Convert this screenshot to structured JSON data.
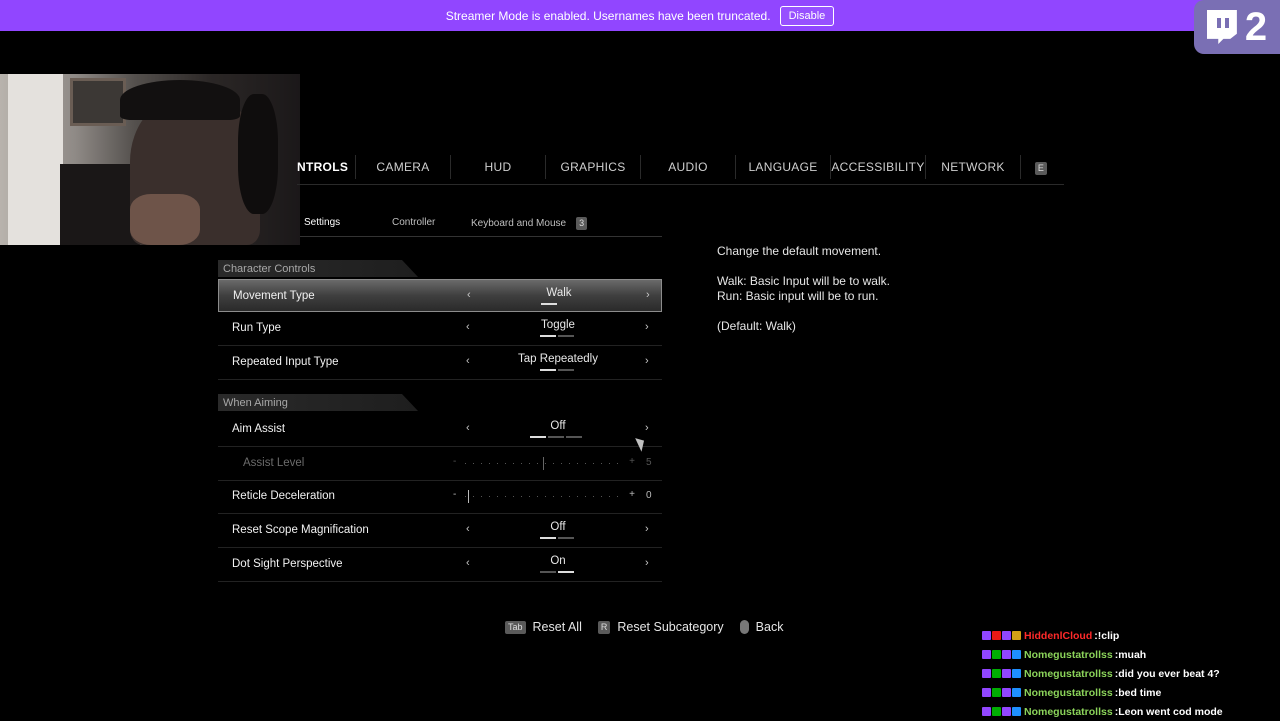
{
  "banner": {
    "text": "Streamer Mode is enabled. Usernames have been truncated.",
    "button": "Disable"
  },
  "badge": {
    "number": "2"
  },
  "tabs": [
    {
      "label": "NTROLS",
      "active": true
    },
    {
      "label": "CAMERA"
    },
    {
      "label": "HUD"
    },
    {
      "label": "GRAPHICS"
    },
    {
      "label": "AUDIO"
    },
    {
      "label": "LANGUAGE"
    },
    {
      "label": "ACCESSIBILITY"
    },
    {
      "label": "NETWORK"
    },
    {
      "label": "E"
    }
  ],
  "subtabs": {
    "settings": "Settings",
    "controller": "Controller",
    "kbm": "Keyboard and Mouse",
    "kbm_key": "3"
  },
  "sections": {
    "character": "Character Controls",
    "aiming": "When Aiming"
  },
  "rows": {
    "movement": {
      "label": "Movement Type",
      "value": "Walk"
    },
    "run": {
      "label": "Run Type",
      "value": "Toggle"
    },
    "repeated": {
      "label": "Repeated Input Type",
      "value": "Tap Repeatedly"
    },
    "aim_assist": {
      "label": "Aim Assist",
      "value": "Off"
    },
    "assist_level": {
      "label": "Assist Level",
      "min": "-",
      "max": "+",
      "value": "5"
    },
    "reticle": {
      "label": "Reticle Deceleration",
      "min": "-",
      "max": "+",
      "value": "0"
    },
    "reset_scope": {
      "label": "Reset Scope Magnification",
      "value": "Off"
    },
    "dot_sight": {
      "label": "Dot Sight Perspective",
      "value": "On"
    }
  },
  "arrows": {
    "left": "‹",
    "right": "›"
  },
  "description": {
    "line1": "Change the default movement.",
    "line2": "Walk: Basic Input will be to walk.",
    "line3": "Run: Basic input will be to run.",
    "line4": "(Default: Walk)"
  },
  "footer": {
    "reset_all_key": "Tab",
    "reset_all": "Reset All",
    "reset_sub_key": "R",
    "reset_sub": "Reset Subcategory",
    "back": "Back"
  },
  "chat": [
    {
      "user": "HiddenlCloud",
      "sep": " : ",
      "text": "!clip",
      "color": "#ff2a2a"
    },
    {
      "user": "Nomegustatrollss",
      "sep": " : ",
      "text": "muah",
      "color": "#8bd35a"
    },
    {
      "user": "Nomegustatrollss",
      "sep": " : ",
      "text": "did you ever beat 4?",
      "color": "#8bd35a"
    },
    {
      "user": "Nomegustatrollss",
      "sep": " : ",
      "text": "bed time",
      "color": "#8bd35a"
    },
    {
      "user": "Nomegustatrollss",
      "sep": " : ",
      "text": "Leon went cod mode",
      "color": "#8bd35a"
    }
  ],
  "colors": {
    "banner": "#9146ff",
    "badge": "#7a6fb4",
    "chat_user_red": "#ff2a2a",
    "chat_user_green": "#8bd35a"
  }
}
